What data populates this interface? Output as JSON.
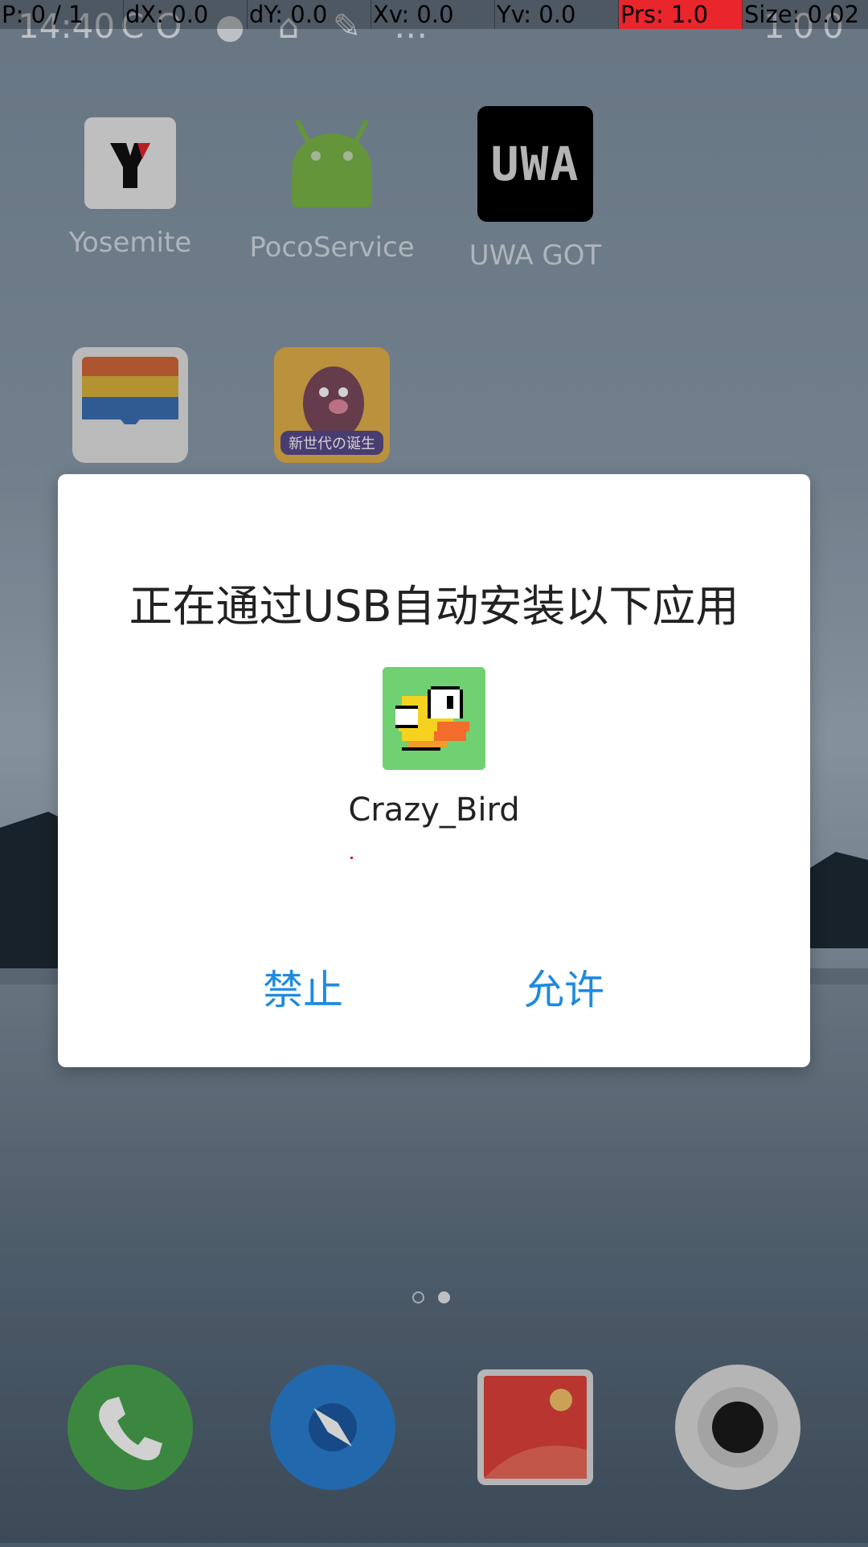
{
  "status_bar": {
    "time": "14:40",
    "left_icons": "CO ● ⌂ ✎ …",
    "battery": "100"
  },
  "debug_overlay": {
    "pointer": "P: 0 / 1",
    "dx": "dX: 0.0",
    "dy": "dY: 0.0",
    "xv": "Xv: 0.0",
    "yv": "Yv: 0.0",
    "prs": "Prs: 1.0",
    "size": "Size: 0.02"
  },
  "home": {
    "apps": [
      {
        "label": "Yosemite",
        "icon": "yosemite-icon"
      },
      {
        "label": "PocoService",
        "icon": "android-robot-icon"
      },
      {
        "label": "UWA GOT",
        "icon": "uwa-icon"
      },
      {
        "label": "",
        "icon": "wallet-icon"
      },
      {
        "label": "",
        "icon": "game-icon"
      }
    ],
    "uwa_text": "UWA",
    "game_banner": "新世代の诞生",
    "page_indicator": {
      "pages": 2,
      "current": 2
    },
    "dock": [
      "phone-icon",
      "compass-icon",
      "gallery-icon",
      "camera-icon"
    ]
  },
  "dialog": {
    "title": "正在通过USB自动安装以下应用",
    "app_name": "Crazy_Bird",
    "deny_label": "禁止",
    "allow_label": "允许",
    "accent_color": "#1f8ae0"
  }
}
